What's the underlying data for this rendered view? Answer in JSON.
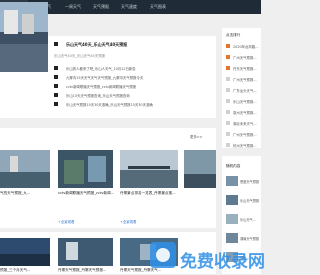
{
  "nav": {
    "items": [
      "首页",
      "城市天气",
      "一周天气",
      "天气预报",
      "天气速度",
      "天气图表"
    ]
  },
  "feature": {
    "title": "乐山天气40天_乐山天气40天预报",
    "subtitle": "乐山天气40天_乐山天气40天预报",
    "list": [
      "天气预报——天气预报——天气预报",
      "乐山的人都来了吧_乐山人天气_10月12日新告",
      "九寨沟15天天气天气天气预报_九寨沟天气预报今天",
      "cctv新闻联播天气预报_cctv新闻联播天气预报",
      "乐山15天天气预报查询_乐山天气预报查询",
      "乐山天气预报15天30天准确_乐山天气预报15天30天准确"
    ]
  },
  "grid": {
    "more": "更多>>",
    "row1": [
      {
        "title": "气的天气预报_九...",
        "fav": "+全景观看"
      },
      {
        "title": "cctv新闻联播天气预报_cctv新闻...",
        "fav": "+全景观看"
      },
      {
        "title": "丹寨景点排名一览表_丹寨景点推...",
        "fav": "+全景观看"
      }
    ],
    "row2": [
      {
        "title": "预报_三个月天气...",
        "fav": ""
      },
      {
        "title": "丹寨天气预报_丹寨天气预报...",
        "fav": ""
      },
      {
        "title": "丹寨天气预报_丹寨天气...",
        "fav": ""
      }
    ]
  },
  "sidebar": {
    "title": "点击排行",
    "items": [
      {
        "text": "2020年台风路...",
        "color": "#e8742b"
      },
      {
        "text": "广州天气预报...",
        "color": "#e8742b"
      },
      {
        "text": "丹东天气预报...",
        "color": "#e8742b"
      },
      {
        "text": "广州天气预报...",
        "color": "#d0d0d0"
      },
      {
        "text": "广东汕头天气...",
        "color": "#d0d0d0"
      },
      {
        "text": "乐山天气预报...",
        "color": "#d0d0d0"
      },
      {
        "text": "泉州天气预报...",
        "color": "#d0d0d0"
      },
      {
        "text": "湖北未来天气...",
        "color": "#d0d0d0"
      },
      {
        "text": "广州天气预报...",
        "color": "#d0d0d0"
      },
      {
        "text": "杭州天气预报...",
        "color": "#d0d0d0"
      }
    ]
  },
  "sidebar2": {
    "title": "随机内容",
    "items": [
      "恩施天气预报",
      "乐山天气预报",
      "乐山天气...",
      "湖南天气预报",
      "湖南..."
    ]
  },
  "watermark": "免费收录网"
}
